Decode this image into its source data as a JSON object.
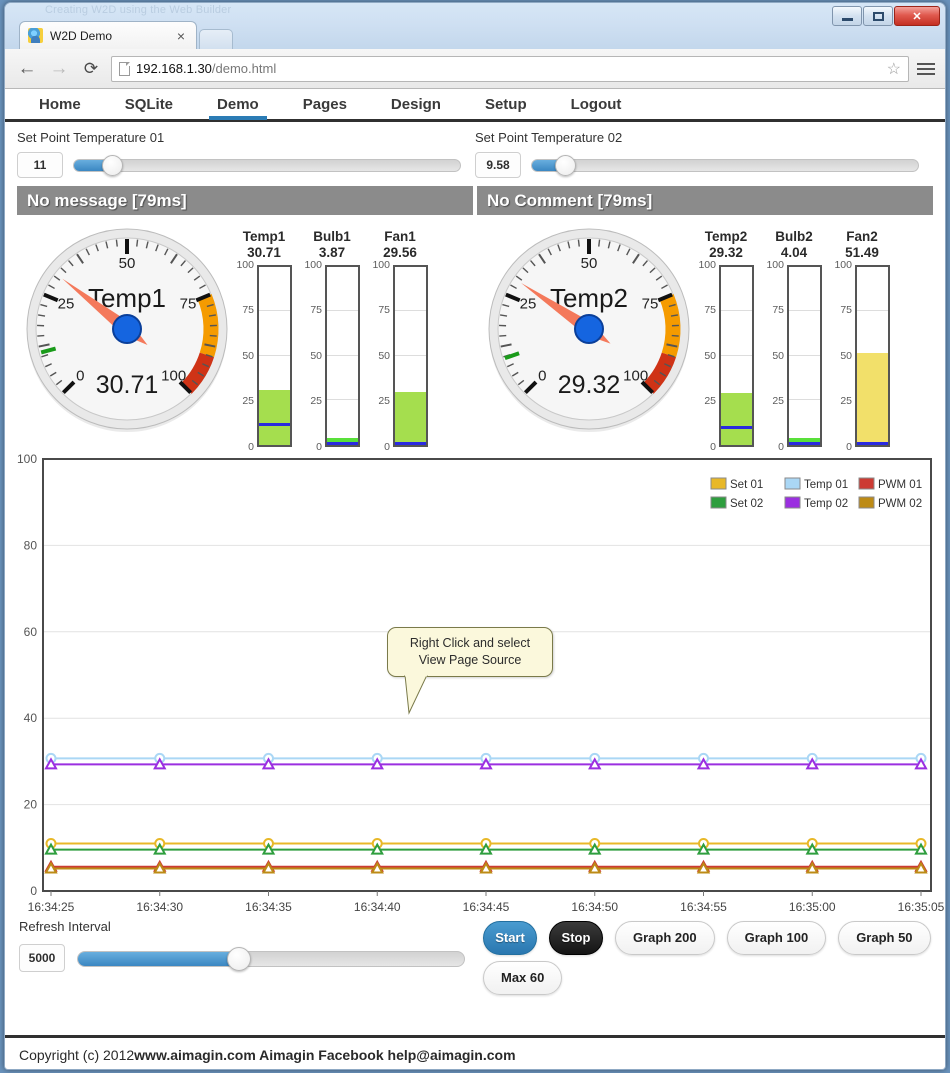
{
  "window": {
    "ghost_title": "Creating W2D using the Web Builder",
    "minimize_label": "Minimize",
    "maximize_label": "Maximize",
    "close_label": "✕"
  },
  "browser": {
    "tab_title": "W2D Demo",
    "tab_close": "×",
    "back_icon": "←",
    "forward_icon": "→",
    "reload_icon": "⟳",
    "url_host": "192.168.1.30",
    "url_path": "/demo.html",
    "star_icon": "☆"
  },
  "nav": {
    "items": [
      {
        "label": "Home",
        "active": false
      },
      {
        "label": "SQLite",
        "active": false
      },
      {
        "label": "Demo",
        "active": true
      },
      {
        "label": "Pages",
        "active": false
      },
      {
        "label": "Design",
        "active": false
      },
      {
        "label": "Setup",
        "active": false
      },
      {
        "label": "Logout",
        "active": false
      }
    ]
  },
  "setpoints": [
    {
      "label": "Set Point Temperature 01",
      "value": "11",
      "slider_percent": 11
    },
    {
      "label": "Set Point Temperature 02",
      "value": "9.58",
      "slider_percent": 9.58
    }
  ],
  "messages": [
    {
      "text": "No message [79ms]"
    },
    {
      "text": "No Comment [79ms]"
    }
  ],
  "panels": [
    {
      "dial": {
        "title": "Temp1",
        "value": "30.71",
        "value_num": 30.71,
        "ticks": [
          "0",
          "25",
          "50",
          "75",
          "100"
        ],
        "warn_color": "#f59b00",
        "alarm_color": "#cf3316",
        "needle_color": "#f4795b",
        "hub_color": "#1565e0",
        "threshold_color": "#1a9b1a",
        "threshold_value": 11
      },
      "bars": [
        {
          "title": "Temp1",
          "value": "30.71",
          "value_num": 30.71,
          "fill_color": "#a5de4e",
          "marker_num": 11
        },
        {
          "title": "Bulb1",
          "value": "3.87",
          "value_num": 3.87,
          "fill_color": "#59e03a",
          "marker_num": 0.6
        },
        {
          "title": "Fan1",
          "value": "29.56",
          "value_num": 29.56,
          "fill_color": "#a5de4e",
          "marker_num": 0.6
        }
      ],
      "bar_scale": [
        "100",
        "75",
        "50",
        "25",
        "0"
      ]
    },
    {
      "dial": {
        "title": "Temp2",
        "value": "29.32",
        "value_num": 29.32,
        "ticks": [
          "0",
          "25",
          "50",
          "75",
          "100"
        ],
        "warn_color": "#f59b00",
        "alarm_color": "#cf3316",
        "needle_color": "#f4795b",
        "hub_color": "#1565e0",
        "threshold_color": "#1a9b1a",
        "threshold_value": 9.58
      },
      "bars": [
        {
          "title": "Temp2",
          "value": "29.32",
          "value_num": 29.32,
          "fill_color": "#a5de4e",
          "marker_num": 9.58
        },
        {
          "title": "Bulb2",
          "value": "4.04",
          "value_num": 4.04,
          "fill_color": "#59e03a",
          "marker_num": 0.6
        },
        {
          "title": "Fan2",
          "value": "51.49",
          "value_num": 51.49,
          "fill_color": "#f2e06a",
          "marker_num": 0.6
        }
      ],
      "bar_scale": [
        "100",
        "75",
        "50",
        "25",
        "0"
      ]
    }
  ],
  "callout": {
    "line1": "Right Click and select",
    "line2": "View Page Source"
  },
  "chart_data": {
    "type": "line",
    "title": "",
    "xlabel": "",
    "ylabel": "",
    "ylim": [
      0,
      100
    ],
    "yticks": [
      0,
      20,
      40,
      60,
      80,
      100
    ],
    "x": [
      "16:34:25",
      "16:34:30",
      "16:34:35",
      "16:34:40",
      "16:34:45",
      "16:34:50",
      "16:34:55",
      "16:35:00",
      "16:35:05"
    ],
    "grid": true,
    "legend_position": "top-right",
    "marker_count": 9,
    "series": [
      {
        "name": "Set 01",
        "color": "#e8b828",
        "marker": "circle",
        "values": [
          11,
          11,
          11,
          11,
          11,
          11,
          11,
          11,
          11
        ]
      },
      {
        "name": "Temp 01",
        "color": "#aad7f5",
        "marker": "circle",
        "values": [
          30.71,
          30.71,
          30.71,
          30.71,
          30.71,
          30.71,
          30.71,
          30.71,
          30.71
        ]
      },
      {
        "name": "PWM 01",
        "color": "#cc3b33",
        "marker": "triangle",
        "values": [
          5.6,
          5.6,
          5.6,
          5.6,
          5.6,
          5.6,
          5.6,
          5.6,
          5.6
        ]
      },
      {
        "name": "Set 02",
        "color": "#2e9e3e",
        "marker": "triangle",
        "values": [
          9.58,
          9.58,
          9.58,
          9.58,
          9.58,
          9.58,
          9.58,
          9.58,
          9.58
        ]
      },
      {
        "name": "Temp 02",
        "color": "#9b2fe0",
        "marker": "triangle",
        "values": [
          29.32,
          29.32,
          29.32,
          29.32,
          29.32,
          29.32,
          29.32,
          29.32,
          29.32
        ]
      },
      {
        "name": "PWM 02",
        "color": "#bd8b16",
        "marker": "triangle",
        "values": [
          5.2,
          5.2,
          5.2,
          5.2,
          5.2,
          5.2,
          5.2,
          5.2,
          5.2
        ]
      }
    ]
  },
  "bottom": {
    "refresh_label": "Refresh Interval",
    "refresh_value": "5000",
    "refresh_percent": 42,
    "buttons_row1": [
      {
        "label": "Start",
        "style": "start"
      },
      {
        "label": "Stop",
        "style": "stop"
      },
      {
        "label": "Graph 200",
        "style": "plain"
      },
      {
        "label": "Graph 100",
        "style": "plain"
      },
      {
        "label": "Graph 50",
        "style": "plain"
      }
    ],
    "buttons_row2": [
      {
        "label": "Max 60",
        "style": "plain"
      }
    ]
  },
  "footer": {
    "prefix": "Copyright (c) 2012 ",
    "bold": "www.aimagin.com Aimagin Facebook help@aimagin.com"
  }
}
